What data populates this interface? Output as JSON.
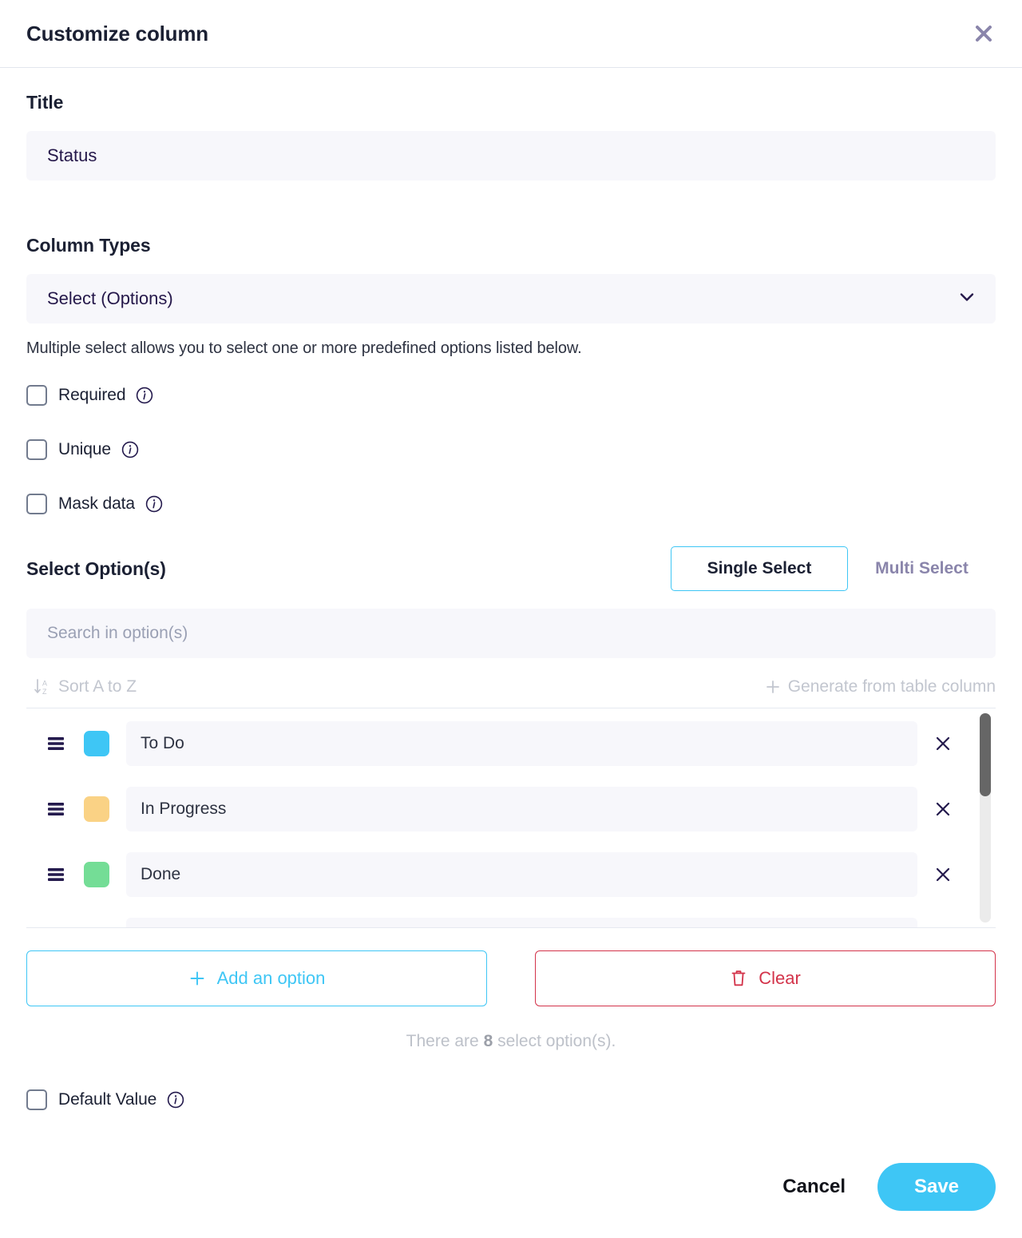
{
  "header": {
    "title": "Customize column",
    "close_icon": "close-icon"
  },
  "title_field": {
    "label": "Title",
    "value": "Status",
    "placeholder": "Title"
  },
  "column_types": {
    "label": "Column Types",
    "selected": "Select (Options)",
    "chevron_icon": "chevron-down-icon",
    "helper_text": "Multiple select allows you to select one or more predefined options listed below."
  },
  "flags": [
    {
      "label": "Required",
      "checked": false,
      "info_icon": "info-icon"
    },
    {
      "label": "Unique",
      "checked": false,
      "info_icon": "info-icon"
    },
    {
      "label": "Mask data",
      "checked": false,
      "info_icon": "info-icon"
    }
  ],
  "select_options": {
    "label": "Select Option(s)",
    "mode_single": "Single Select",
    "mode_multi": "Multi Select",
    "active_mode": "Single Select",
    "search_placeholder": "Search in option(s)",
    "sort_label": "Sort A to Z",
    "sort_icon": "sort-a-to-z-icon",
    "generate_label": "Generate from table column",
    "generate_icon": "plus-icon",
    "items": [
      {
        "color": "#3ec6f5",
        "value": "To Do",
        "remove_icon": "close-icon",
        "drag_icon": "drag-handle-icon"
      },
      {
        "color": "#fad285",
        "value": "In Progress",
        "remove_icon": "close-icon",
        "drag_icon": "drag-handle-icon"
      },
      {
        "color": "#74dd96",
        "value": "Done",
        "remove_icon": "close-icon",
        "drag_icon": "drag-handle-icon"
      },
      {
        "color": "#f2f2f7",
        "value": "",
        "remove_icon": "close-icon",
        "drag_icon": "drag-handle-icon"
      }
    ],
    "add_label": "Add an option",
    "add_icon": "plus-icon",
    "clear_label": "Clear",
    "clear_icon": "trash-icon",
    "count_prefix": "There are ",
    "count_value": "8",
    "count_suffix": " select option(s)."
  },
  "default_value": {
    "label": "Default Value",
    "checked": false,
    "info_icon": "info-icon"
  },
  "footer": {
    "cancel_label": "Cancel",
    "save_label": "Save"
  },
  "colors": {
    "accent": "#3ec6f5",
    "danger": "#d3334a",
    "muted_purple": "#8a85ab",
    "navy": "#25184a",
    "field_bg": "#f7f7fb"
  }
}
